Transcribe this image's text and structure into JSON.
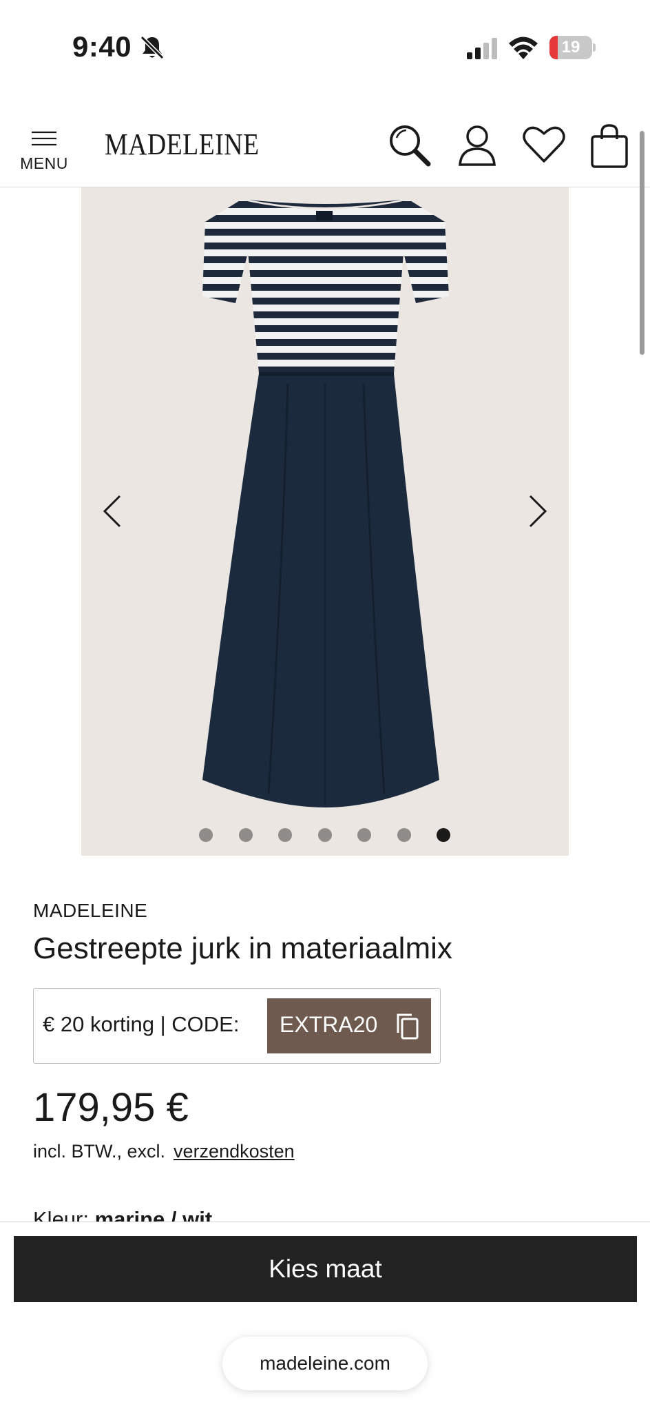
{
  "status_bar": {
    "time": "9:40",
    "battery_level": "19",
    "icons": [
      "bell-slash-icon",
      "signal-icon",
      "wifi-icon",
      "battery-icon"
    ],
    "battery_color": "#e5393a"
  },
  "header": {
    "menu_label": "MENU",
    "logo": "MADELEINE",
    "icons": [
      "search-icon",
      "account-icon",
      "wishlist-heart-icon",
      "shopping-bag-icon"
    ]
  },
  "gallery": {
    "slide_count": 7,
    "active_slide": 7,
    "background": "#ebe6e2"
  },
  "product": {
    "brand": "MADELEINE",
    "title": "Gestreepte jurk in materiaalmix",
    "promo_text": "€ 20 korting | CODE:",
    "promo_code": "EXTRA20",
    "price": "179,95 €",
    "tax_text": "incl. BTW., excl.",
    "shipping_link": "verzendkosten",
    "color_label": "Kleur:",
    "color_value": "marine / wit"
  },
  "colors": {
    "promo_button": "#6e5a4f",
    "cta_button": "#222222"
  },
  "sticky": {
    "cta_label": "Kies maat",
    "url": "madeleine.com"
  }
}
